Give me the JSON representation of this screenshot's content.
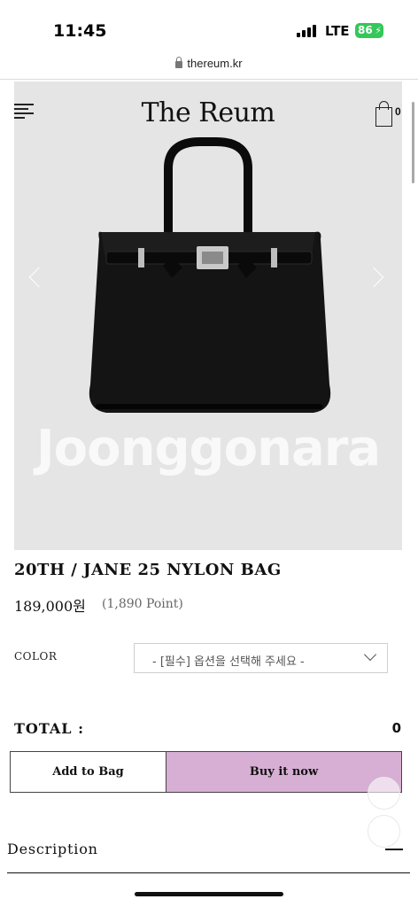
{
  "status_bar": {
    "time": "11:45",
    "network": "LTE",
    "battery": "86"
  },
  "browser": {
    "url": "thereum.kr"
  },
  "header": {
    "logo": "The Reum",
    "cart_count": "0"
  },
  "gallery": {
    "watermark": "Joonggonara"
  },
  "product": {
    "title": "20TH / JANE 25 NYLON BAG",
    "price": "189,000원",
    "points": "(1,890 Point)"
  },
  "options": {
    "color_label": "COLOR",
    "color_selected": "- [필수] 옵션을 선택해 주세요 -"
  },
  "total": {
    "label": "TOTAL :",
    "value": "0"
  },
  "actions": {
    "add_to_bag": "Add to Bag",
    "buy_now": "Buy it now"
  },
  "sections": {
    "description": "Description"
  },
  "colors": {
    "buy_button": "#d7afd4",
    "battery": "#34c759",
    "image_bg": "#e5e5e5"
  }
}
